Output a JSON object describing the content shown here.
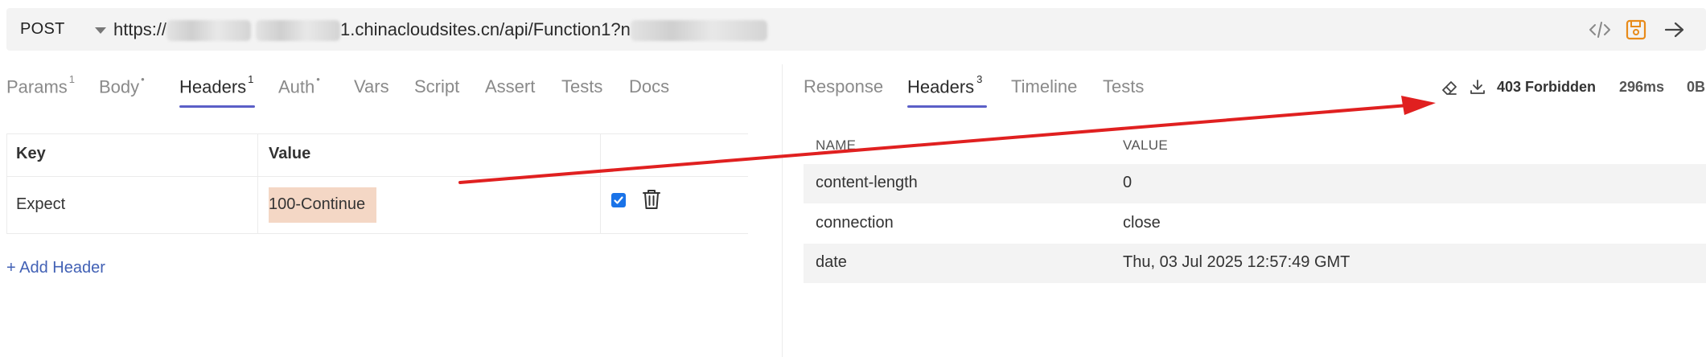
{
  "request": {
    "method": "POST",
    "url_prefix": "https://",
    "url_visible": "1.chinacloudsites.cn/api/Function1?n",
    "icons": [
      "code-icon",
      "save-icon",
      "send-arrow-icon"
    ]
  },
  "request_tabs": [
    {
      "label": "Params",
      "sup": "1"
    },
    {
      "label": "Body",
      "sup": "•"
    },
    {
      "label": "Headers",
      "sup": "1",
      "active": true
    },
    {
      "label": "Auth",
      "sup": "•"
    },
    {
      "label": "Vars",
      "sup": ""
    },
    {
      "label": "Script",
      "sup": ""
    },
    {
      "label": "Assert",
      "sup": ""
    },
    {
      "label": "Tests",
      "sup": ""
    },
    {
      "label": "Docs",
      "sup": ""
    }
  ],
  "request_headers": {
    "col_key": "Key",
    "col_value": "Value",
    "rows": [
      {
        "key": "Expect",
        "value": "100-Continue",
        "enabled": true
      }
    ],
    "add_label": "+ Add Header"
  },
  "response_tabs": [
    {
      "label": "Response",
      "sup": ""
    },
    {
      "label": "Headers",
      "sup": "3",
      "active": true
    },
    {
      "label": "Timeline",
      "sup": ""
    },
    {
      "label": "Tests",
      "sup": ""
    }
  ],
  "response_meta": {
    "status": "403 Forbidden",
    "time": "296ms",
    "size": "0B"
  },
  "response_headers": {
    "col_name": "NAME",
    "col_value": "VALUE",
    "rows": [
      {
        "name": "content-length",
        "value": "0"
      },
      {
        "name": "connection",
        "value": "close"
      },
      {
        "name": "date",
        "value": "Thu, 03 Jul 2025 12:57:49 GMT"
      }
    ]
  },
  "colors": {
    "accent": "#5b5fc7",
    "save_icon": "#e88b1a",
    "annotation_arrow": "#e02020",
    "highlight": "#f4d7c5",
    "link": "#4261b5"
  }
}
